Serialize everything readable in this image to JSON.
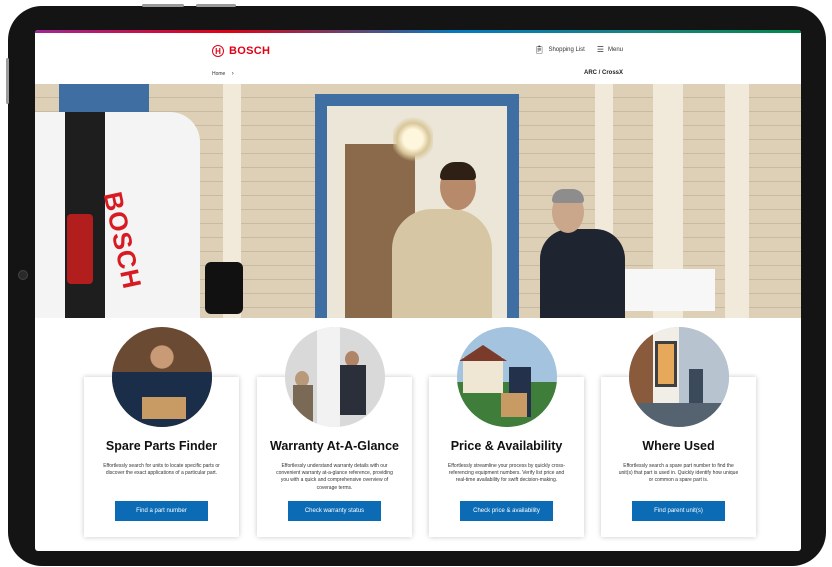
{
  "header": {
    "brand": "BOSCH",
    "shopping_list": "Shopping List",
    "menu": "Menu",
    "breadcrumb_home": "Home",
    "breadcrumb_sep": "›",
    "page_title": "ARC / CrossX"
  },
  "hero": {
    "van_logo": "BOSCH"
  },
  "cards": [
    {
      "title": "Spare Parts Finder",
      "description": "Effortlessly search for units to locate specific parts or discover the exact applications of a particular part.",
      "button": "Find a part number"
    },
    {
      "title": "Warranty At-A-Glance",
      "description": "Effortlessly understand warranty details with our convenient warranty at-a-glance reference, providing you with a quick and comprehensive overview of coverage terms.",
      "button": "Check warranty status"
    },
    {
      "title": "Price & Availability",
      "description": "Effortlessly streamline your process by quickly cross-referencing equipment numbers. Verify list price and real-time availability for swift decision-making.",
      "button": "Check price & availability"
    },
    {
      "title": "Where Used",
      "description": "Effortlessly search a spare part number to find the unit(s) that part is used in. Quickly identify how unique or common a spare part is.",
      "button": "Find parent unit(s)"
    }
  ],
  "colors": {
    "brand_red": "#e20015",
    "button_blue": "#0b6cb5",
    "door_blue": "#3f6fa2"
  }
}
